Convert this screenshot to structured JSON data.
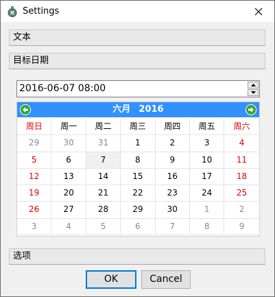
{
  "window": {
    "title": "Settings"
  },
  "sections": {
    "text_label": "文本",
    "target_date_label": "目标日期",
    "options_label": "选项"
  },
  "datetime_input": {
    "value": "2016-06-07 08:00"
  },
  "calendar": {
    "month_label": "六月",
    "year_label": "2016",
    "weekdays": [
      "周日",
      "周一",
      "周二",
      "周三",
      "周四",
      "周五",
      "周六"
    ],
    "weeks": [
      [
        "29",
        "30",
        "31",
        "1",
        "2",
        "3",
        "4"
      ],
      [
        "5",
        "6",
        "7",
        "8",
        "9",
        "10",
        "11"
      ],
      [
        "12",
        "13",
        "14",
        "15",
        "16",
        "17",
        "18"
      ],
      [
        "19",
        "20",
        "21",
        "22",
        "23",
        "24",
        "25"
      ],
      [
        "26",
        "27",
        "28",
        "29",
        "30",
        "1",
        "2"
      ],
      [
        "3",
        "4",
        "5",
        "6",
        "7",
        "8",
        "9"
      ]
    ],
    "selected_day": "7",
    "colors": {
      "header": "#3390ff",
      "weekend": "#e00000",
      "other_month": "#8a8a8a"
    }
  },
  "buttons": {
    "ok_label": "OK",
    "cancel_label": "Cancel"
  }
}
